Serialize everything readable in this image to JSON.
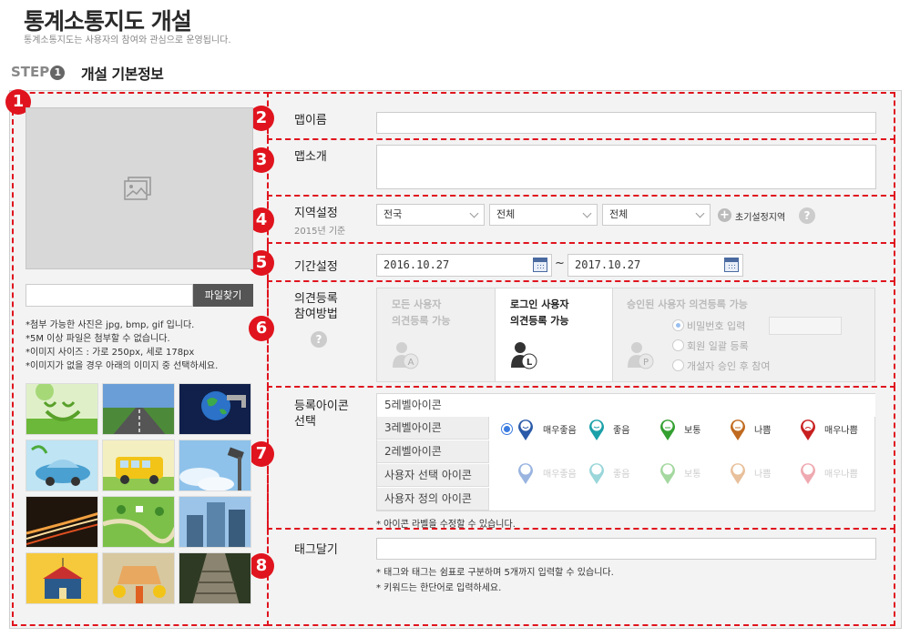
{
  "header": {
    "title": "통계소통지도 개설",
    "subtitle": "통계소통지도는 사용자의 참여와 관심으로 운영됩니다."
  },
  "step": {
    "prefix": "STEP",
    "number": "1",
    "title": "개설 기본정보"
  },
  "markers": [
    "1",
    "2",
    "3",
    "4",
    "5",
    "6",
    "7",
    "8"
  ],
  "left_panel": {
    "image_placeholder_icon": "image-icon",
    "file_button": "파일찾기",
    "notes": [
      "*첨부 가능한 사진은 jpg, bmp, gif 입니다.",
      "*5M 이상 파일은 첨부할 수 없습니다.",
      "*이미지 사이즈 : 가로 250px, 세로 178px",
      "*이미지가 없을 경우 아래의 이미지 중 선택하세요."
    ],
    "thumbnails": [
      "smiley-grass-thumbnail",
      "road-thumbnail",
      "earth-faucet-thumbnail",
      "eco-car-thumbnail",
      "school-bus-thumbnail",
      "cctv-sky-thumbnail",
      "night-highway-thumbnail",
      "map-park-thumbnail",
      "skyscraper-thumbnail",
      "school-building-thumbnail",
      "under-construction-thumbnail",
      "stone-stairs-thumbnail"
    ]
  },
  "map_name": {
    "label": "맵이름",
    "value": ""
  },
  "map_intro": {
    "label": "맵소개",
    "value": ""
  },
  "region": {
    "label": "지역설정",
    "sub": "2015년 기준",
    "select1": "전국",
    "select2": "전체",
    "select3": "전체",
    "init_label": "초기설정지역",
    "plus_icon": "plus-icon",
    "help_icon": "help-icon"
  },
  "period": {
    "label": "기간설정",
    "start": "2016.10.27",
    "tilde": "~",
    "end": "2017.10.27"
  },
  "participation": {
    "label_line1": "의견등록",
    "label_line2": "참여방법",
    "option_all_1": "모든 사용자",
    "option_all_2": "의견등록 가능",
    "option_login_1": "로그인 사용자",
    "option_login_2": "의견등록 가능",
    "option_approved": "승인된 사용자 의견등록 가능",
    "sub_password": "비밀번호 입력",
    "sub_member": "회원 일괄 등록",
    "sub_approval": "개설자 승인 후 참여",
    "badge_all": "A",
    "badge_login": "L",
    "badge_approved": "P",
    "selected": "로그인 사용자 의견등록 가능"
  },
  "icon_select": {
    "label_line1": "등록아이콘",
    "label_line2": "선택",
    "tabs": [
      "5레벨아이콘",
      "3레벨아이콘",
      "2레벨아이콘",
      "사용자 선택 아이콘",
      "사용자 정의 아이콘"
    ],
    "active_tab": "5레벨아이콘",
    "levels": [
      "매우좋음",
      "좋음",
      "보통",
      "나쁨",
      "매우나쁨"
    ],
    "colors": [
      "#2a5aa8",
      "#1aa0a8",
      "#33a030",
      "#c06a20",
      "#c82020"
    ],
    "faded_colors": [
      "#9ab4e0",
      "#9ad6da",
      "#a4d8a0",
      "#e8c09c",
      "#eeaab0"
    ],
    "note": "* 아이콘 라벨을 수정할 수 있습니다."
  },
  "tags": {
    "label": "태그달기",
    "value": "",
    "note1": "* 태그와 태그는 쉼표로 구분하며 5개까지 입력할 수 있습니다.",
    "note2": "* 키워드는 한단어로 입력하세요."
  }
}
